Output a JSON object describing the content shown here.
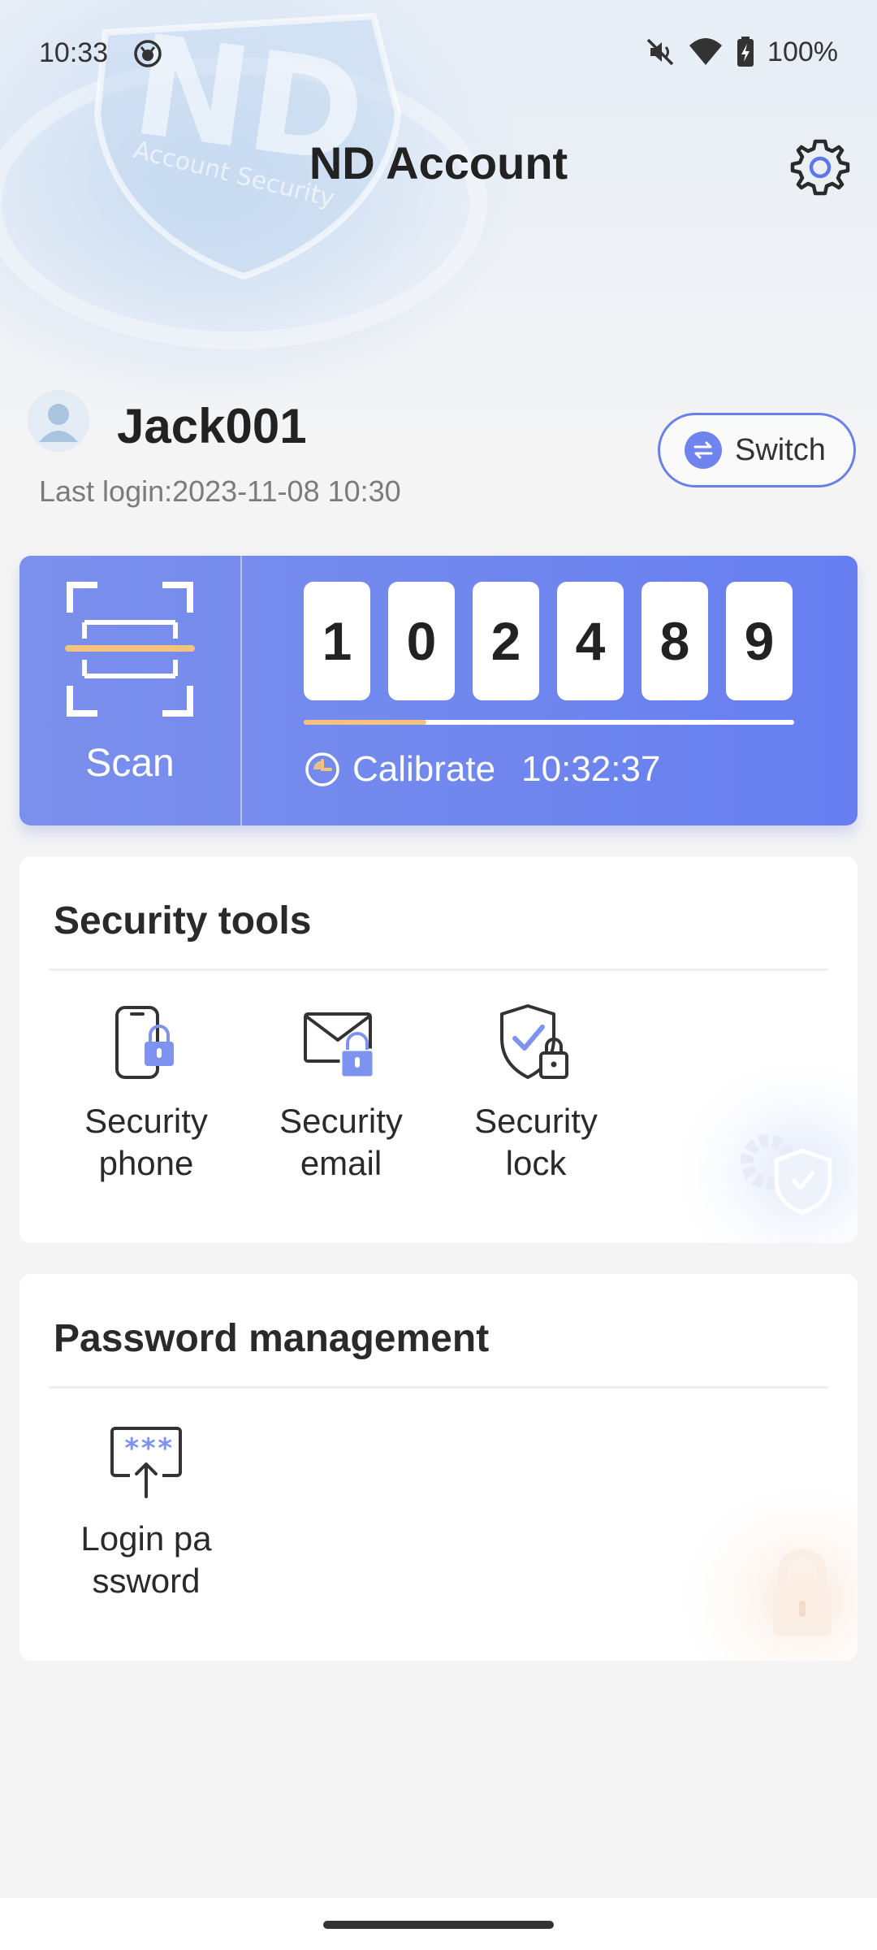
{
  "status_bar": {
    "time": "10:33",
    "battery": "100%",
    "icons": [
      "app-notification-icon",
      "mute-icon",
      "wifi-icon",
      "battery-charging-icon"
    ]
  },
  "header": {
    "title": "ND Account",
    "settings_icon": "gear-icon",
    "bg_art": {
      "logo_text": "ND",
      "logo_subtext": "Account Security"
    }
  },
  "profile": {
    "username": "Jack001",
    "last_login": "Last login:2023-11-08 10:30",
    "switch_label": "Switch"
  },
  "token": {
    "scan_label": "Scan",
    "digits": [
      "1",
      "0",
      "2",
      "4",
      "8",
      "9"
    ],
    "progress": 0.25,
    "calibrate_label": "Calibrate",
    "calibrate_time": "10:32:37"
  },
  "security_tools": {
    "title": "Security tools",
    "items": [
      {
        "label": "Security\nphone",
        "icon": "phone-lock-icon"
      },
      {
        "label": "Security\nemail",
        "icon": "email-lock-icon"
      },
      {
        "label": "Security\nlock",
        "icon": "shield-lock-icon"
      }
    ]
  },
  "password_management": {
    "title": "Password management",
    "items": [
      {
        "label": "Login pa\nssword",
        "icon": "password-upload-icon"
      }
    ]
  },
  "colors": {
    "accent": "#6f84ec",
    "progress": "#f3c37e",
    "background": "#f4f4f5"
  }
}
